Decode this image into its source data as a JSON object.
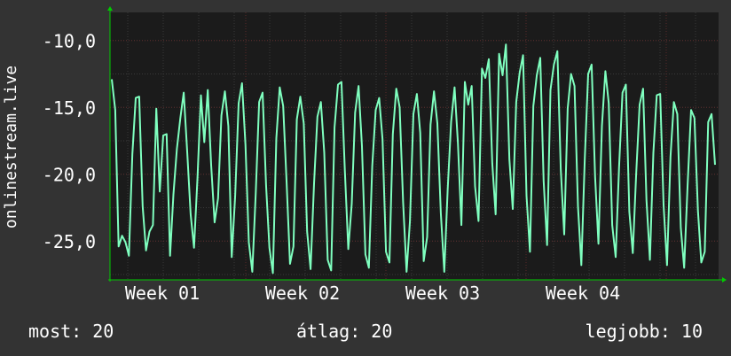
{
  "chart_data": {
    "type": "line",
    "ylabel": "onlinestream.live",
    "ylim": [
      -27.9,
      -7.9
    ],
    "y_ticks": [
      -10,
      -15,
      -20,
      -25
    ],
    "y_tick_labels": [
      "-10,0",
      "-15,0",
      "-20,0",
      "-25,0"
    ],
    "x_tick_labels": [
      "Week 01",
      "Week 02",
      "Week 03",
      "Week 04"
    ],
    "grid": true,
    "colors": {
      "background": "#333333",
      "plot": "#1b1b1b",
      "line": "#7fffbf",
      "axis": "#00cc00",
      "grid": "#3a3a3a",
      "minor_grid": "#5a2a2a"
    },
    "series": [
      {
        "values": [
          -12.9,
          -15.2,
          -25.4,
          -24.6,
          -25.1,
          -26.1,
          -18.5,
          -14.3,
          -14.2,
          -22.4,
          -25.7,
          -24.3,
          -23.8,
          -15.1,
          -21.3,
          -17.1,
          -17.0,
          -26.1,
          -21.5,
          -18.1,
          -15.8,
          -13.9,
          -18.3,
          -23.0,
          -25.5,
          -20.3,
          -14.1,
          -17.6,
          -13.7,
          -19.3,
          -23.6,
          -21.8,
          -15.6,
          -13.8,
          -16.4,
          -26.2,
          -21.6,
          -14.7,
          -13.2,
          -17.8,
          -25.1,
          -27.3,
          -21.4,
          -14.6,
          -13.9,
          -20.8,
          -25.5,
          -27.4,
          -17.3,
          -13.5,
          -14.9,
          -20.5,
          -26.7,
          -25.4,
          -15.9,
          -14.2,
          -16.2,
          -24.3,
          -27.1,
          -20.7,
          -15.7,
          -14.6,
          -18.4,
          -26.4,
          -27.2,
          -16.5,
          -13.3,
          -13.1,
          -19.7,
          -25.6,
          -22.2,
          -15.4,
          -13.4,
          -17.9,
          -26.0,
          -27.0,
          -19.4,
          -15.2,
          -14.3,
          -17.4,
          -25.8,
          -26.6,
          -17.0,
          -13.6,
          -15.0,
          -22.1,
          -27.3,
          -23.5,
          -15.5,
          -14.0,
          -16.9,
          -26.5,
          -24.7,
          -16.3,
          -13.8,
          -16.2,
          -22.9,
          -27.3,
          -21.2,
          -16.1,
          -13.5,
          -17.7,
          -23.8,
          -13.1,
          -14.8,
          -13.4,
          -20.9,
          -23.5,
          -12.1,
          -12.8,
          -11.4,
          -19.2,
          -23.0,
          -11.0,
          -12.6,
          -10.3,
          -18.9,
          -22.6,
          -14.6,
          -12.4,
          -11.1,
          -21.6,
          -25.8,
          -14.9,
          -12.6,
          -11.3,
          -20.5,
          -25.3,
          -13.7,
          -11.8,
          -10.8,
          -19.6,
          -24.5,
          -15.1,
          -12.5,
          -13.4,
          -22.4,
          -26.8,
          -18.8,
          -12.5,
          -11.8,
          -20.2,
          -25.2,
          -16.4,
          -12.3,
          -14.7,
          -23.8,
          -26.2,
          -19.5,
          -13.9,
          -13.3,
          -22.8,
          -25.9,
          -20.0,
          -14.8,
          -13.6,
          -21.9,
          -26.4,
          -18.4,
          -14.1,
          -14.0,
          -22.3,
          -26.8,
          -18.7,
          -14.6,
          -15.5,
          -24.0,
          -27.0,
          -20.8,
          -15.2,
          -15.8,
          -22.7,
          -26.6,
          -25.8,
          -16.1,
          -15.5,
          -19.3
        ]
      }
    ]
  },
  "stats": {
    "now": "most: 20",
    "avg": "átlag: 20",
    "best": "legjobb: 10"
  }
}
